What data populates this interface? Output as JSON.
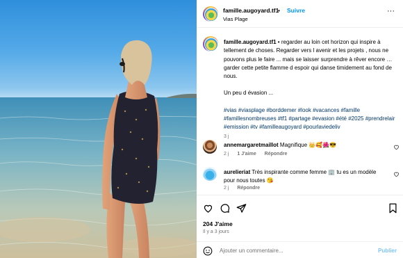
{
  "post": {
    "username": "famille.augoyard.tf1",
    "separator": "•",
    "follow_label": "Suivre",
    "location": "Vias Plage",
    "more_label": "···"
  },
  "caption": {
    "username": "famille.augoyard.tf1",
    "text": " • regarder au loin cet horizon qui inspire à tellement de choses. Regarder vers l avenir et les projets , nous ne pouvons plus le faire ... mais se laisser surprendre à rêver encore … garder cette petite flamme d espoir qui danse timidement au fond de nous.",
    "line2": "Un peu d évasion ...",
    "hashtags": "#vias #viasplage #borddemer #look #vacances #famille #famillesnombreuses #tf1 #partage #evasion #été #2025 #prendrelair #emission #tv #familleaugoyard #pourlaviedeliv",
    "time": "3 j"
  },
  "comments": [
    {
      "username": "annemargaretmaillot",
      "text": " Magnifique 👑🥰🌺😎",
      "time": "2 j",
      "likes": "1 J'aime",
      "reply": "Répondre"
    },
    {
      "username": "aurelieriat",
      "text": " Très inspirante comme femme 🏢 tu es un modèle pour nous toutes 😘",
      "time": "2 j",
      "reply": "Répondre"
    }
  ],
  "footer": {
    "likes": "204 J'aime",
    "ago": "Il y a 3 jours",
    "comment_placeholder": "Ajouter un commentaire...",
    "publish_label": "Publier"
  },
  "icons": {
    "like": "heart-icon",
    "comment": "comment-icon",
    "share": "share-icon",
    "save": "bookmark-icon",
    "emoji": "smiley-icon",
    "more": "more-icon"
  }
}
